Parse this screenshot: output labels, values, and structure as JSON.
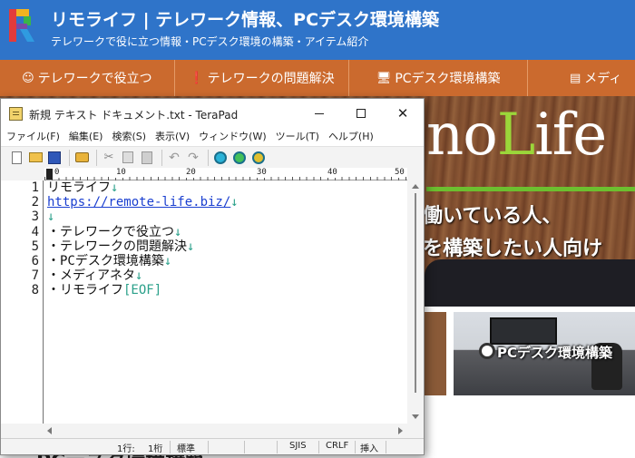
{
  "site": {
    "title": "リモライフ | テレワーク情報、PCデスク環境構築",
    "tagline": "テレワークで役に立つ情報・PCデスク環境の構築・アイテム紹介",
    "nav": [
      {
        "icon": "☺",
        "label": "テレワークで役立つ"
      },
      {
        "icon": "❗",
        "label": "テレワークの問題解決"
      },
      {
        "icon": "🖥",
        "label": "PCデスク環境構築"
      },
      {
        "icon": "▤",
        "label": "メディ"
      }
    ],
    "hero": {
      "logo_pre": "no",
      "logo_accent": "L",
      "logo_post": "ife",
      "line1": "働いている人、",
      "line2": "を構築したい人向け"
    },
    "card_label": "PCデスク環境構築",
    "bottom_heading": "PCデスク環境構築"
  },
  "window": {
    "title": "新規 テキスト ドキュメント.txt - TeraPad",
    "controls": {
      "minimize": "—",
      "maximize": "☐",
      "close": "✕"
    },
    "menu": [
      "ファイル(F)",
      "編集(E)",
      "検索(S)",
      "表示(V)",
      "ウィンドウ(W)",
      "ツール(T)",
      "ヘルプ(H)"
    ],
    "ruler_labels": [
      "0",
      "10",
      "20",
      "30",
      "40",
      "50"
    ],
    "line_numbers": [
      "1",
      "2",
      "3",
      "4",
      "5",
      "6",
      "7",
      "8"
    ],
    "lines": [
      {
        "text": "リモライフ",
        "mark": "↓"
      },
      {
        "text": "https://remote-life.biz/",
        "mark": "↓"
      },
      {
        "text": "",
        "mark": "↓"
      },
      {
        "text": "・テレワークで役立つ",
        "mark": "↓"
      },
      {
        "text": "・テレワークの問題解決",
        "mark": "↓"
      },
      {
        "text": "・PCデスク環境構築",
        "mark": "↓"
      },
      {
        "text": "・メディアネタ",
        "mark": "↓"
      },
      {
        "text": "・リモライフ",
        "mark": "[EOF]"
      }
    ],
    "status": {
      "line": "1行:",
      "col": "1桁",
      "mode": "標準",
      "encoding": "SJIS",
      "newline": "CRLF",
      "insert": "挿入"
    }
  }
}
